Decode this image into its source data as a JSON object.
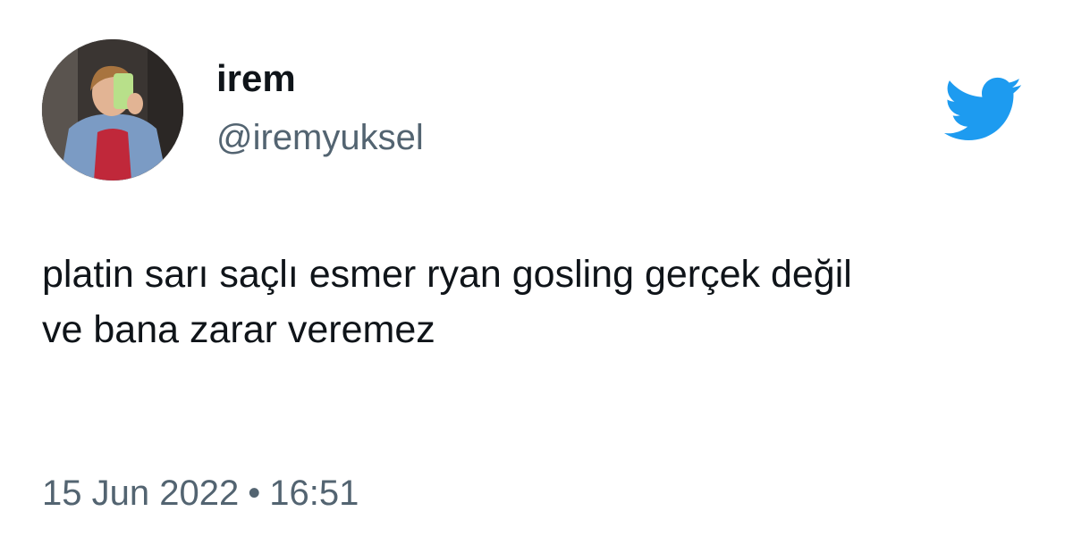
{
  "user": {
    "display_name": "irem",
    "handle": "@iremyuksel",
    "avatar_icon": "profile-photo"
  },
  "brand": {
    "logo_icon": "twitter-bird-icon",
    "color": "#1d9bf0"
  },
  "tweet": {
    "text_lines": [
      "platin sarı saçlı esmer ryan gosling gerçek değil",
      "ve bana zarar veremez"
    ],
    "date": "15 Jun 2022",
    "separator": "•",
    "time": "16:51"
  },
  "colors": {
    "primary_text": "#0f1419",
    "secondary_text": "#536471",
    "background": "#ffffff"
  }
}
